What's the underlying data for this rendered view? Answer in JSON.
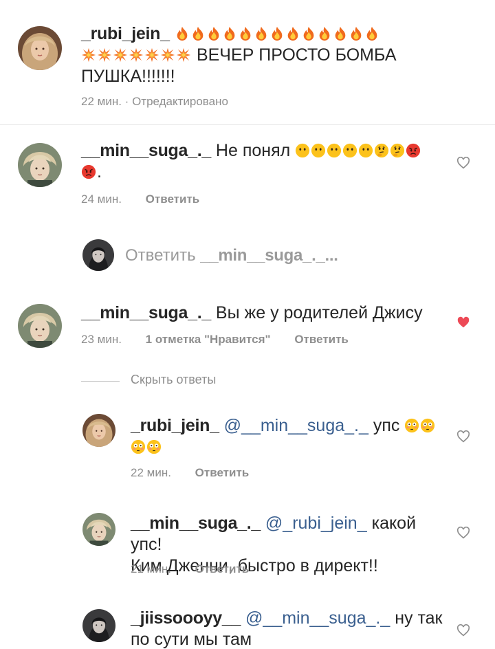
{
  "caption": {
    "username": "_rubi_jein_",
    "emoji_line1": "fire-emoji x13",
    "emoji_line2": "collision-emoji x7",
    "text": "ВЕЧЕР ПРОСТО БОМБА",
    "text2": "ПУШКА!!!!!!!",
    "time": "22 мин.",
    "edited": "Отредактировано"
  },
  "comments": [
    {
      "username": "__min__suga_._",
      "text": "Не понял",
      "time": "24 мин.",
      "reply": "Ответить",
      "liked": false
    },
    {
      "username": "__min__suga_._",
      "text": "Вы же у родителей Джису",
      "time": "23 мин.",
      "likes": "1 отметка \"Нравится\"",
      "reply": "Ответить",
      "liked": true
    }
  ],
  "reply_compose": {
    "placeholder_prefix": "Ответить",
    "placeholder_user": "__min__suga_._..."
  },
  "hide_replies": "Скрыть ответы",
  "replies": [
    {
      "username": "_rubi_jein_",
      "mention": "@__min__suga_._",
      "text": "упс",
      "time": "22 мин.",
      "reply": "Ответить"
    },
    {
      "username": "__min__suga_._",
      "mention": "@_rubi_jein_",
      "text_line1": "какой упс!",
      "text_line2": "Ким Дженни, быстро в директ!!",
      "time": "21 мин.",
      "reply": "Ответить"
    },
    {
      "username": "_jiissoooyy__",
      "mention": "@__min__suga_._",
      "text_line1": "ну так",
      "text_line2": "по сути мы там"
    }
  ],
  "colors": {
    "text": "#262626",
    "meta": "#8e8e8e",
    "mention": "#3a5f8f",
    "liked_heart": "#ed4956"
  }
}
